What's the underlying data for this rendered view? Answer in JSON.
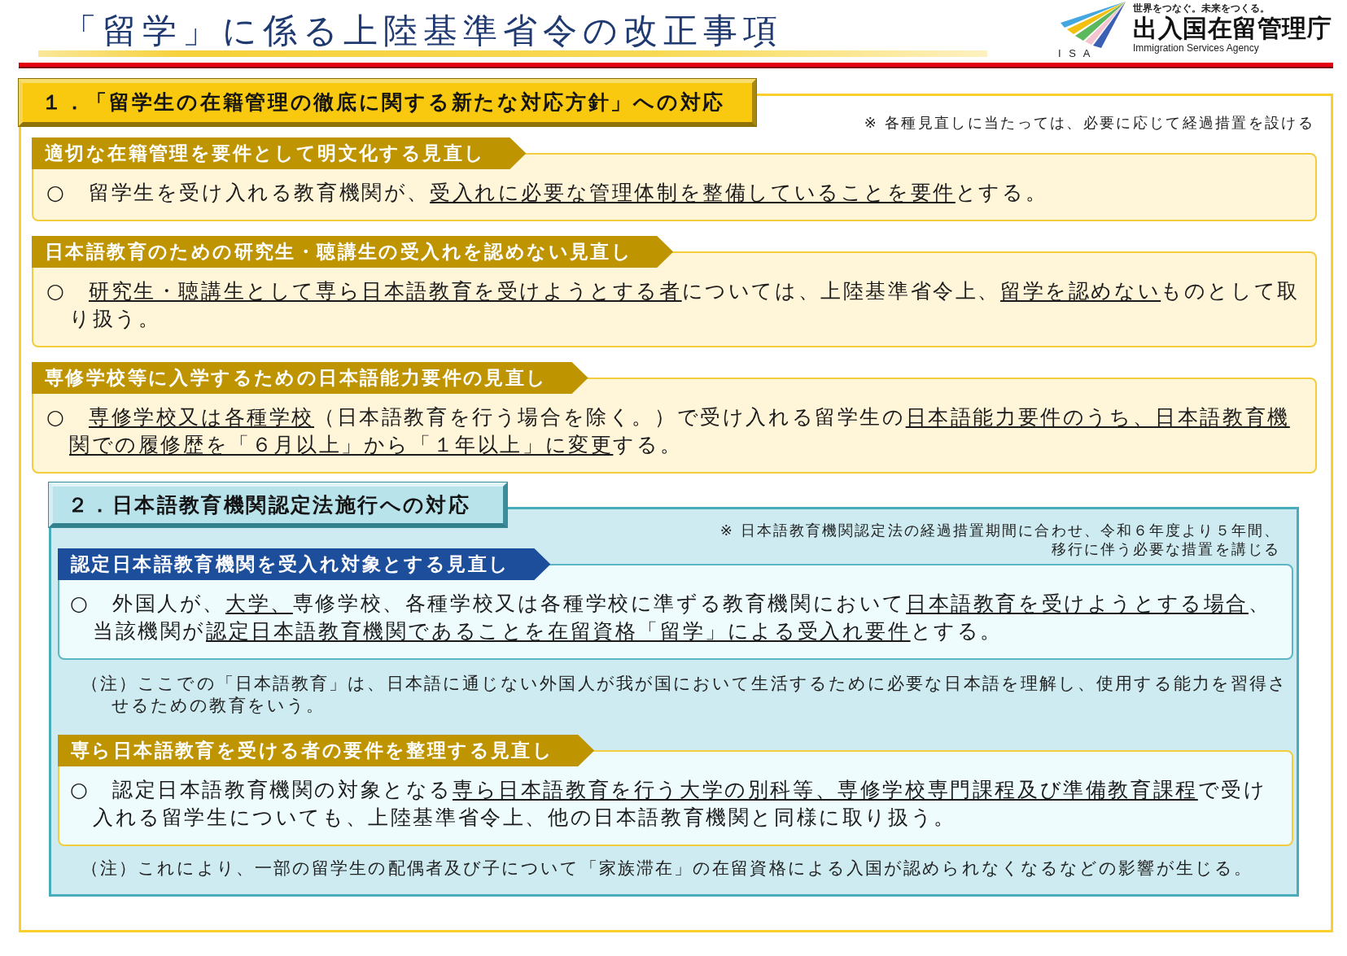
{
  "header": {
    "title": "「留学」に係る上陸基準省令の改正事項",
    "logo": {
      "tagline": "世界をつなぐ。未来をつくる。",
      "name": "出入国在留管理庁",
      "english": "Immigration Services Agency",
      "initials": "I S A"
    }
  },
  "sections": [
    {
      "kind": "plain",
      "heading": "１．「留学生の在籍管理の徹底に関する新たな対応方針」への対応",
      "note_lines": [
        "※ 各種見直しに当たっては、必要に応じて経過措置を設ける"
      ],
      "subsections": [
        {
          "kind": "standard",
          "title": "適切な在籍管理を要件として明文化する見直し",
          "body": [
            {
              "text": "○　留学生を受け入れる教育機関が、",
              "underlined": false
            },
            {
              "text": "受入れに必要な管理体制を整備していることを要件",
              "underlined": true
            },
            {
              "text": "とする。",
              "underlined": false
            }
          ]
        },
        {
          "kind": "standard",
          "title": "日本語教育のための研究生・聴講生の受入れを認めない見直し",
          "body": [
            {
              "text": "○　",
              "underlined": false
            },
            {
              "text": "研究生・聴講生として専ら日本語教育を受けようとする者",
              "underlined": true
            },
            {
              "text": "については、上陸基準省令上、",
              "underlined": false
            },
            {
              "text": "留学を認めない",
              "underlined": true
            },
            {
              "text": "ものとして取り扱う。",
              "underlined": false
            }
          ]
        },
        {
          "kind": "standard",
          "title": "専修学校等に入学するための日本語能力要件の見直し",
          "body": [
            {
              "text": "○　",
              "underlined": false
            },
            {
              "text": "専修学校又は各種学校",
              "underlined": true
            },
            {
              "text": "（日本語教育を行う場合を除く。）で受け入れる留学生の",
              "underlined": false
            },
            {
              "text": "日本語能力要件のうち、日本語教育機関での履修歴を「６月以上」から「１年以上」に変更",
              "underlined": true
            },
            {
              "text": "する。",
              "underlined": false
            }
          ]
        }
      ]
    },
    {
      "kind": "boxed",
      "heading": "２．日本語教育機関認定法施行への対応",
      "note_lines": [
        "※ 日本語教育機関認定法の経過措置期間に合わせ、令和６年度より５年間、",
        "移行に伴う必要な措置を講じる"
      ],
      "subsections": [
        {
          "kind": "primary",
          "title": "認定日本語教育機関を受入れ対象とする見直し",
          "body": [
            {
              "text": "○　外国人が、",
              "underlined": false
            },
            {
              "text": "大学、",
              "underlined": true
            },
            {
              "text": "専修学校、各種学校又は各種学校に準ずる教育機関において",
              "underlined": false
            },
            {
              "text": "日本語教育を受けようとする場合",
              "underlined": true
            },
            {
              "text": "、当該機関が",
              "underlined": false
            },
            {
              "text": "認定日本語教育機関であることを在留資格「留学」による受入れ要件",
              "underlined": true
            },
            {
              "text": "とする。",
              "underlined": false
            }
          ],
          "footnote": "（注）ここでの「日本語教育」は、日本語に通じない外国人が我が国において生活するために必要な日本語を理解し、使用する能力を習得させるための教育をいう。"
        },
        {
          "kind": "standard",
          "title": "専ら日本語教育を受ける者の要件を整理する見直し",
          "body": [
            {
              "text": "○　認定日本語教育機関の対象となる",
              "underlined": false
            },
            {
              "text": "専ら日本語教育を行う大学の別科等、専修学校専門課程及び準備教育課程",
              "underlined": true
            },
            {
              "text": "で受け入れる留学生についても、上陸基準省令上、他の日本語教育機関と同様に取り扱う。",
              "underlined": false
            }
          ],
          "footnote": "（注）これにより、一部の留学生の配偶者及び子について「家族滞在」の在留資格による入国が認められなくなるなどの影響が生じる。"
        }
      ]
    }
  ]
}
